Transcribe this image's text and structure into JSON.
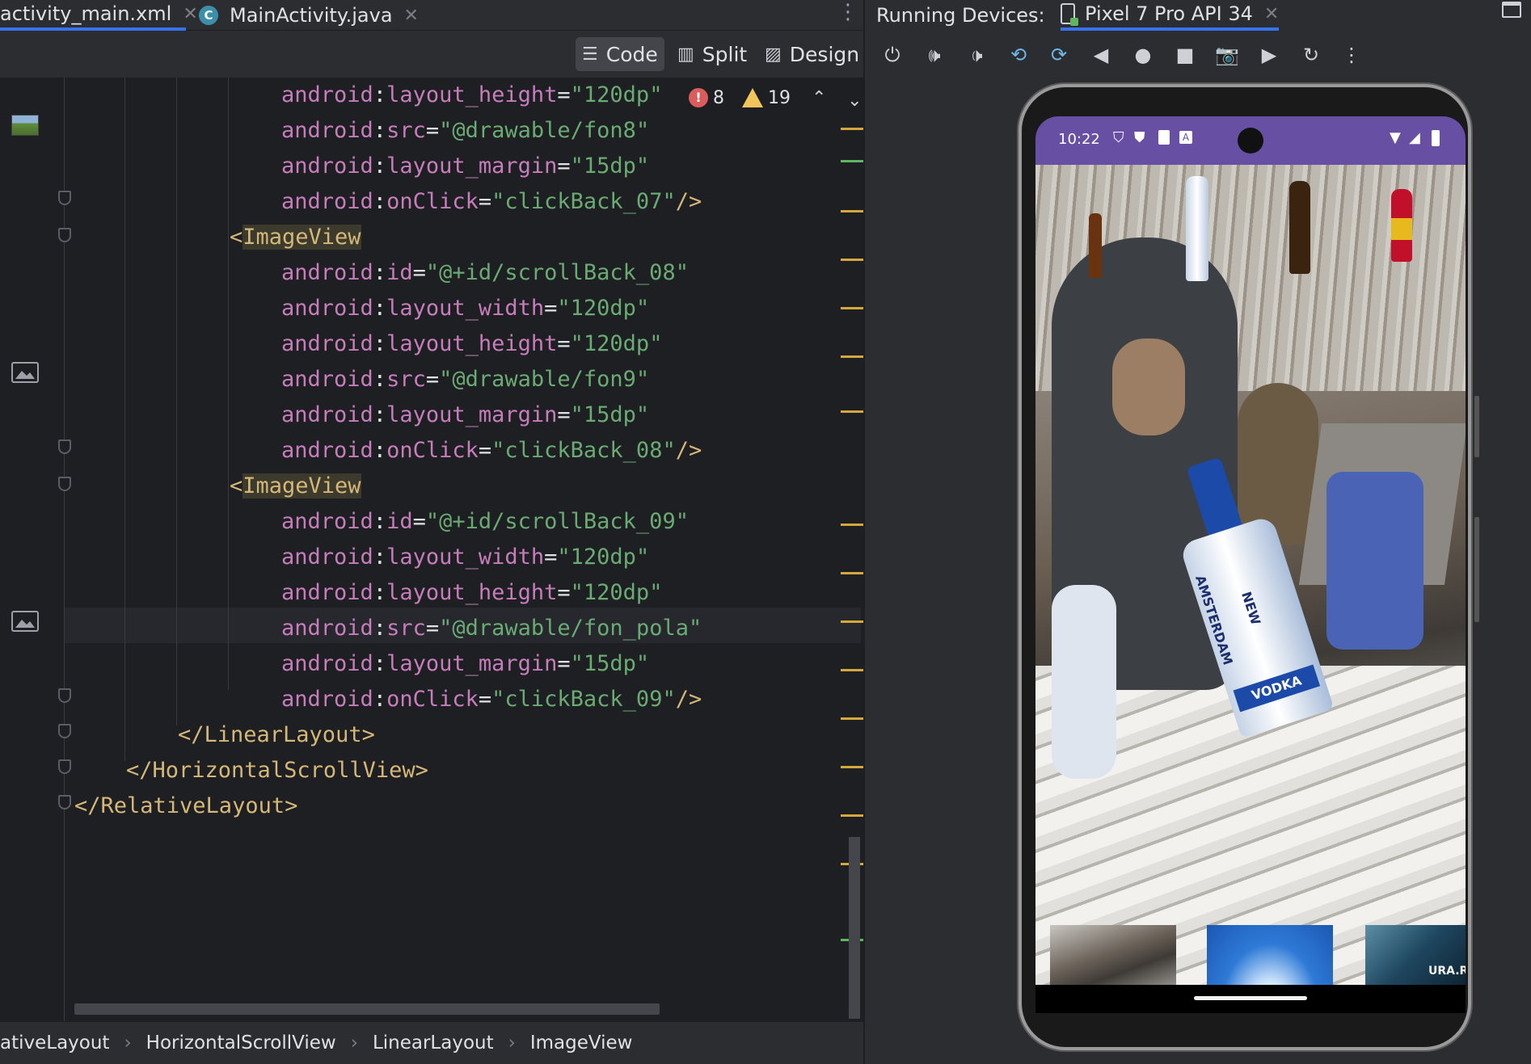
{
  "editor_tabs": [
    {
      "label": "activity_main.xml",
      "active": true
    },
    {
      "label": "MainActivity.java",
      "active": false
    }
  ],
  "view_modes": [
    "Code",
    "Split",
    "Design"
  ],
  "active_view_mode": "Code",
  "inspection": {
    "errors": "8",
    "warnings": "19"
  },
  "code_lines": [
    [
      [
        "ns",
        "android"
      ],
      [
        "col",
        ":"
      ],
      [
        "attr",
        "layout_height"
      ],
      [
        "eq",
        "="
      ],
      [
        "val",
        "\"120dp\""
      ]
    ],
    [
      [
        "ns",
        "android"
      ],
      [
        "col",
        ":"
      ],
      [
        "attr",
        "src"
      ],
      [
        "eq",
        "="
      ],
      [
        "val",
        "\"@drawable/fon8\""
      ]
    ],
    [
      [
        "ns",
        "android"
      ],
      [
        "col",
        ":"
      ],
      [
        "attr",
        "layout_margin"
      ],
      [
        "eq",
        "="
      ],
      [
        "val",
        "\"15dp\""
      ]
    ],
    [
      [
        "ns",
        "android"
      ],
      [
        "col",
        ":"
      ],
      [
        "attr",
        "onClick"
      ],
      [
        "eq",
        "="
      ],
      [
        "val",
        "\"clickBack_07\""
      ],
      [
        "tag",
        "/>"
      ]
    ],
    [
      [
        "tag",
        "<"
      ],
      [
        "tagname",
        "ImageView"
      ]
    ],
    [
      [
        "ns",
        "android"
      ],
      [
        "col",
        ":"
      ],
      [
        "attr",
        "id"
      ],
      [
        "eq",
        "="
      ],
      [
        "val",
        "\"@+id/scrollBack_08\""
      ]
    ],
    [
      [
        "ns",
        "android"
      ],
      [
        "col",
        ":"
      ],
      [
        "attr",
        "layout_width"
      ],
      [
        "eq",
        "="
      ],
      [
        "val",
        "\"120dp\""
      ]
    ],
    [
      [
        "ns",
        "android"
      ],
      [
        "col",
        ":"
      ],
      [
        "attr",
        "layout_height"
      ],
      [
        "eq",
        "="
      ],
      [
        "val",
        "\"120dp\""
      ]
    ],
    [
      [
        "ns",
        "android"
      ],
      [
        "col",
        ":"
      ],
      [
        "attr",
        "src"
      ],
      [
        "eq",
        "="
      ],
      [
        "val",
        "\"@drawable/fon9\""
      ]
    ],
    [
      [
        "ns",
        "android"
      ],
      [
        "col",
        ":"
      ],
      [
        "attr",
        "layout_margin"
      ],
      [
        "eq",
        "="
      ],
      [
        "val",
        "\"15dp\""
      ]
    ],
    [
      [
        "ns",
        "android"
      ],
      [
        "col",
        ":"
      ],
      [
        "attr",
        "onClick"
      ],
      [
        "eq",
        "="
      ],
      [
        "val",
        "\"clickBack_08\""
      ],
      [
        "tag",
        "/>"
      ]
    ],
    [
      [
        "tag",
        "<"
      ],
      [
        "tagname",
        "ImageView"
      ]
    ],
    [
      [
        "ns",
        "android"
      ],
      [
        "col",
        ":"
      ],
      [
        "attr",
        "id"
      ],
      [
        "eq",
        "="
      ],
      [
        "val",
        "\"@+id/scrollBack_09\""
      ]
    ],
    [
      [
        "ns",
        "android"
      ],
      [
        "col",
        ":"
      ],
      [
        "attr",
        "layout_width"
      ],
      [
        "eq",
        "="
      ],
      [
        "val",
        "\"120dp\""
      ]
    ],
    [
      [
        "ns",
        "android"
      ],
      [
        "col",
        ":"
      ],
      [
        "attr",
        "layout_height"
      ],
      [
        "eq",
        "="
      ],
      [
        "val",
        "\"120dp\""
      ]
    ],
    [
      [
        "ns",
        "android"
      ],
      [
        "col",
        ":"
      ],
      [
        "attr",
        "src"
      ],
      [
        "eq",
        "="
      ],
      [
        "val",
        "\"@drawable/fon_pola\""
      ]
    ],
    [
      [
        "ns",
        "android"
      ],
      [
        "col",
        ":"
      ],
      [
        "attr",
        "layout_margin"
      ],
      [
        "eq",
        "="
      ],
      [
        "val",
        "\"15dp\""
      ]
    ],
    [
      [
        "ns",
        "android"
      ],
      [
        "col",
        ":"
      ],
      [
        "attr",
        "onClick"
      ],
      [
        "eq",
        "="
      ],
      [
        "val",
        "\"clickBack_09\""
      ],
      [
        "tag",
        "/>"
      ]
    ],
    [
      [
        "tag",
        "</LinearLayout>"
      ]
    ],
    [
      [
        "tag",
        "</HorizontalScrollView>"
      ]
    ],
    [
      [
        "tag",
        "</RelativeLayout>"
      ]
    ]
  ],
  "breadcrumb": [
    "ativeLayout",
    "HorizontalScrollView",
    "LinearLayout",
    "ImageView"
  ],
  "running_devices": {
    "label": "Running Devices:",
    "device_tab": "Pixel 7 Pro API 34"
  },
  "device_toolbar": [
    "power-icon",
    "volume-up-icon",
    "volume-down-icon",
    "rotate-left-icon",
    "rotate-right-icon",
    "back-icon",
    "home-icon",
    "overview-icon",
    "camera-icon",
    "video-icon",
    "reset-icon",
    "more-icon"
  ],
  "phone": {
    "time": "10:22",
    "status_color": "#6750a4",
    "vodka_label": "NEW AMSTERDAM",
    "vodka_sub": "VODKA",
    "watermark": "URA.RU"
  },
  "colors": {
    "editor_bg": "#1e1f22",
    "panel_bg": "#2b2d30",
    "accent": "#3574f0",
    "tag": "#d5b778",
    "attr": "#c77dbb",
    "string": "#6aab73"
  }
}
